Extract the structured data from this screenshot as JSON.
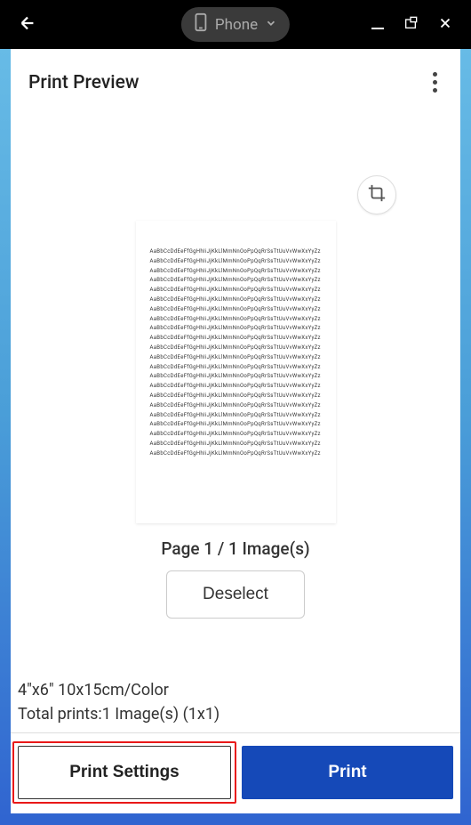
{
  "topbar": {
    "device_label": "Phone"
  },
  "header": {
    "title": "Print Preview"
  },
  "preview": {
    "page_info": "Page 1 / 1 Image(s)",
    "deselect_label": "Deselect"
  },
  "bottom": {
    "media_info": "4\"x6\" 10x15cm/Color",
    "total_info": "Total prints:1 Image(s) (1x1)",
    "settings_label": "Print Settings",
    "print_label": "Print"
  },
  "icons": {
    "back": "back-arrow-icon",
    "phone": "phone-icon",
    "chevron": "chevron-down-icon",
    "minimize": "minimize-icon",
    "window": "window-icon",
    "close": "close-icon",
    "menu": "vertical-dots-icon",
    "crop": "crop-icon"
  }
}
